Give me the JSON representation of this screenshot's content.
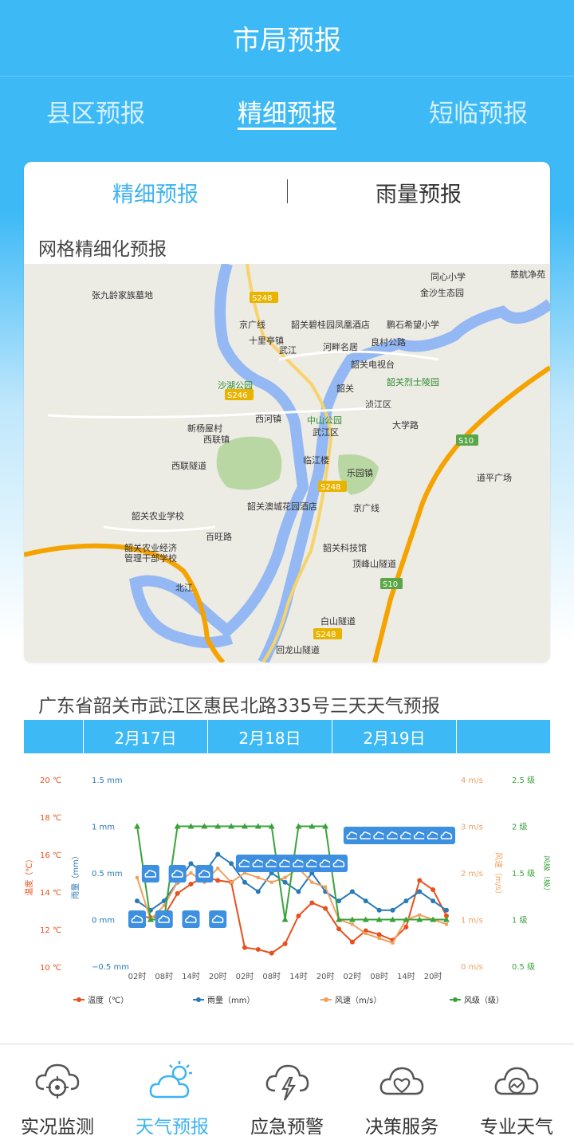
{
  "app": {
    "title": "市局预报"
  },
  "top_tabs": [
    {
      "label": "县区预报",
      "active": false
    },
    {
      "label": "精细预报",
      "active": true
    },
    {
      "label": "短临预报",
      "active": false
    }
  ],
  "sub_tabs": [
    {
      "label": "精细预报",
      "active": true
    },
    {
      "label": "雨量预报",
      "active": false
    }
  ],
  "map": {
    "title": "网格精细化预报",
    "labels": [
      "张九龄家族墓地",
      "同心小学",
      "慈航净苑",
      "金沙生态园",
      "京广线",
      "韶关碧桂园凤凰酒店",
      "鹏石希望小学",
      "十里亭镇",
      "武江",
      "河畔名居",
      "良村公路",
      "韶关电视台",
      "沙湖公园",
      "韶关",
      "韶关烈士陵园",
      "西河镇",
      "中山公园",
      "浈江区",
      "新杨屋村",
      "武江区",
      "西联镇",
      "大学路",
      "西联隧道",
      "临江楼",
      "乐园镇",
      "道平广场",
      "韶关农业学校",
      "韶关澳城花园酒店",
      "京广线",
      "百旺路",
      "韶关科技馆",
      "韶关农业经济",
      "管理干部学校",
      "北江",
      "顶峰山隧道",
      "白山隧道",
      "回龙山隧道",
      "S248",
      "S246",
      "S248",
      "S10",
      "S10",
      "S248"
    ]
  },
  "forecast": {
    "title": "广东省韶关市武江区惠民北路335号三天天气预报",
    "dates": [
      "2月17日",
      "2月18日",
      "2月19日"
    ]
  },
  "chart_data": {
    "type": "line",
    "x": [
      "02时",
      "05时",
      "08时",
      "11时",
      "14时",
      "17时",
      "20时",
      "23时",
      "02时",
      "05时",
      "08时",
      "11时",
      "14时",
      "17时",
      "20时",
      "23时",
      "02时",
      "05时",
      "08时",
      "11时",
      "14时",
      "17时",
      "20时",
      "23时"
    ],
    "xticks": [
      "02时",
      "08时",
      "14时",
      "20时",
      "02时",
      "08时",
      "14时",
      "20时",
      "02时",
      "08时",
      "14时",
      "20时"
    ],
    "y_axes": {
      "temp": {
        "label": "温度（℃）",
        "ticks": [
          "20 ℃",
          "18 ℃",
          "16 ℃",
          "14 ℃",
          "12 ℃",
          "10 ℃"
        ],
        "range": [
          10,
          20
        ],
        "color": "#e8501e"
      },
      "rain": {
        "label": "雨量（mm）",
        "ticks": [
          "1.5 mm",
          "1 mm",
          "0.5 mm",
          "0 mm",
          "−0.5 mm"
        ],
        "range": [
          -0.5,
          1.5
        ],
        "color": "#2a7ab6"
      },
      "wind_speed": {
        "label": "风速（m/s）",
        "ticks": [
          "4 m/s",
          "3 m/s",
          "2 m/s",
          "1 m/s",
          "0 m/s"
        ],
        "range": [
          0,
          4
        ],
        "color": "#f0a060"
      },
      "wind_level": {
        "label": "风级（级）",
        "ticks": [
          "2.5 级",
          "2 级",
          "1.5 级",
          "1 级",
          "0.5 级"
        ],
        "range": [
          0.5,
          2.5
        ],
        "color": "#3aa23a"
      }
    },
    "series": [
      {
        "name": "温度（℃）",
        "color": "#e8501e",
        "values": [
          12.7,
          12.6,
          12.7,
          13.9,
          14.4,
          14.8,
          14.6,
          14.5,
          11.0,
          10.9,
          10.7,
          11.2,
          12.7,
          13.4,
          13.1,
          12.0,
          11.3,
          11.9,
          11.7,
          11.4,
          12.1,
          14.6,
          14.1,
          12.7
        ]
      },
      {
        "name": "雨量（mm）",
        "color": "#2a7ab6",
        "values": [
          0.2,
          0.1,
          0.2,
          0.4,
          0.6,
          0.5,
          0.7,
          0.6,
          0.4,
          0.3,
          0.5,
          0.4,
          0.3,
          0.5,
          0.3,
          0.2,
          0.3,
          0.2,
          0.1,
          0.1,
          0.2,
          0.3,
          0.2,
          0.1
        ]
      },
      {
        "name": "风速（m/s）",
        "color": "#f0a060",
        "values": [
          1.9,
          1.0,
          1.3,
          1.8,
          2.0,
          1.8,
          2.1,
          1.8,
          2.0,
          1.9,
          1.8,
          1.9,
          2.1,
          1.8,
          1.7,
          1.0,
          0.9,
          0.7,
          0.6,
          0.5,
          1.0,
          1.1,
          1.0,
          0.9
        ]
      },
      {
        "name": "风级（级）",
        "color": "#3aa23a",
        "values": [
          2,
          1,
          1,
          2,
          2,
          2,
          2,
          2,
          2,
          2,
          2,
          1,
          2,
          2,
          2,
          1,
          1,
          1,
          1,
          1,
          1,
          1,
          1,
          1
        ]
      }
    ],
    "legend": [
      "温度（℃）",
      "雨量（mm）",
      "风速（m/s）",
      "风级（级）"
    ],
    "legend_position": "bottom"
  },
  "bottom_nav": [
    {
      "label": "实况监测",
      "icon": "cloud-target-icon",
      "active": false
    },
    {
      "label": "天气预报",
      "icon": "sun-cloud-icon",
      "active": true
    },
    {
      "label": "应急预警",
      "icon": "cloud-lightning-icon",
      "active": false
    },
    {
      "label": "决策服务",
      "icon": "cloud-heart-icon",
      "active": false
    },
    {
      "label": "专业天气",
      "icon": "cloud-chart-icon",
      "active": false
    }
  ]
}
